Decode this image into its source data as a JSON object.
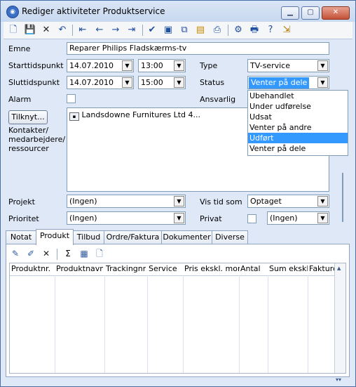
{
  "window": {
    "title": "Rediger aktiviteter Produktservice",
    "icon": "app-icon",
    "controls": [
      "minimize-icon",
      "maximize-icon",
      "close-icon"
    ]
  },
  "toolbar": {
    "icons": [
      "new-icon",
      "save-icon",
      "delete-icon",
      "undo-icon",
      "first-record-icon",
      "previous-record-icon",
      "next-record-icon",
      "last-record-icon",
      "check-icon",
      "preview-icon",
      "copy-icon",
      "attach-icon",
      "print-icon",
      "properties-icon",
      "printer-icon",
      "help-icon",
      "exit-icon"
    ]
  },
  "form": {
    "subject_label": "Emne",
    "subject_value": "Reparer Philips Fladskærms-tv",
    "start_label": "Starttidspunkt",
    "start_date": "14.07.2010",
    "start_time": "13:00",
    "end_label": "Sluttidspunkt",
    "end_date": "14.07.2010",
    "end_time": "15:00",
    "alarm_label": "Alarm",
    "type_label": "Type",
    "type_value": "TV-service",
    "status_label": "Status",
    "status_value": "Venter på dele",
    "responsible_label": "Ansvarlig",
    "new_button": "Tilknyt...",
    "contacts_label": "Kontakter/\nmedarbejdere/\nressourcer",
    "contact_item": "Landsdowne Furnitures Ltd 4...",
    "project_label": "Projekt",
    "project_value": "(Ingen)",
    "show_time_label": "Vis tid som",
    "show_time_value": "Optaget",
    "priority_label": "Prioritet",
    "priority_value": "(Ingen)",
    "private_label": "Privat",
    "private_value": "(Ingen)"
  },
  "status_dropdown": {
    "options": [
      "Ubehandlet",
      "Under udførelse",
      "Udsat",
      "Venter på andre",
      "Udført",
      "Venter på dele"
    ],
    "highlighted": "Udført"
  },
  "tabs": [
    "Notat",
    "Produkt",
    "Tilbud",
    "Ordre/Faktura",
    "Dokumenter",
    "Diverse"
  ],
  "active_tab": "Produkt",
  "product_table": {
    "columns": [
      "Produktnr.",
      "Produktnavn",
      "Trackingnr.",
      "Service",
      "Pris ekskl. moms",
      "Antal",
      "Sum ekskl.",
      "Fakture"
    ],
    "rows": []
  },
  "colors": {
    "accent": "#3399ff",
    "window_bg": "#dfe8f7",
    "border": "#7f9db9"
  }
}
